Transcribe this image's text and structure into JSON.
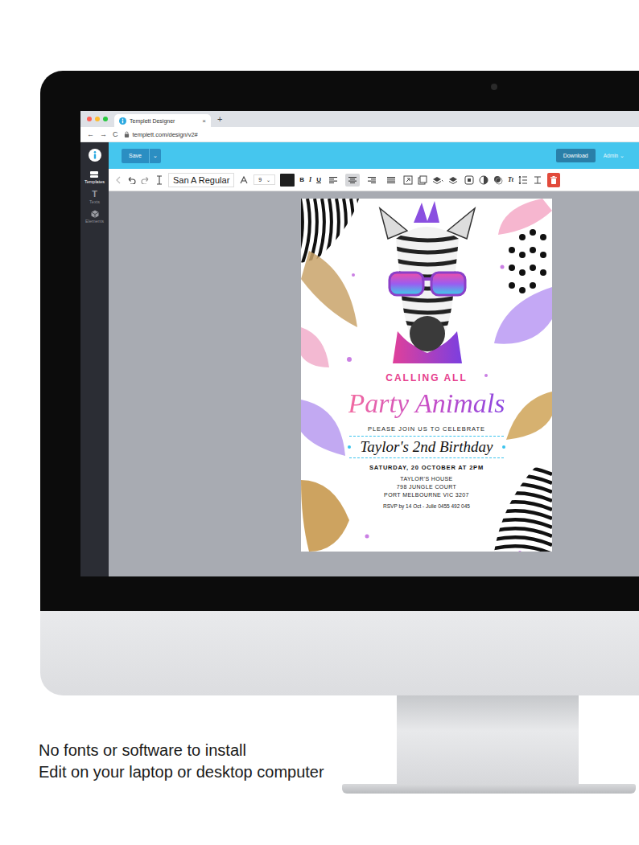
{
  "browser": {
    "tab": {
      "title": "Templett Designer",
      "close": "×"
    },
    "new_tab": "+",
    "nav": [
      "←",
      "→",
      "C"
    ],
    "url": "templett.com/design/v2#"
  },
  "toolbar": {
    "save": "Save",
    "save_menu": "⌄",
    "download": "Download",
    "user": "Admin ⌄"
  },
  "sidebar": {
    "items": [
      {
        "label": "Templates",
        "kind": "stack",
        "glyph": "",
        "selected": true
      },
      {
        "label": "Texts",
        "kind": "letter",
        "glyph": "T",
        "selected": false
      },
      {
        "label": "Elements",
        "kind": "cube",
        "glyph": "",
        "selected": false
      }
    ]
  },
  "format_bar": {
    "font": "San A Regular",
    "size": "9",
    "size_menu": "⌄",
    "bold": "B",
    "italic": "I",
    "underline": "U",
    "align": [
      {
        "name": "left",
        "selected": false
      },
      {
        "name": "center",
        "selected": true
      },
      {
        "name": "right",
        "selected": false
      },
      {
        "name": "justify",
        "selected": false
      }
    ],
    "text_tool": "Tt"
  },
  "invitation": {
    "headline": "CALLING ALL",
    "title": "Party Animals",
    "intro": "PLEASE JOIN US TO CELEBRATE",
    "name": "Taylor's 2nd Birthday",
    "name_selected": true,
    "date": "SATURDAY, 20 OCTOBER AT 2PM",
    "address": [
      "TAYLOR'S HOUSE",
      "798 JUNGLE COURT",
      "PORT MELBOURNE VIC 3207"
    ],
    "rsvp": "RSVP by 14 Oct - Julie 0455 492 045"
  },
  "caption": [
    "No fonts or software to install",
    "Edit on your laptop or desktop computer"
  ]
}
